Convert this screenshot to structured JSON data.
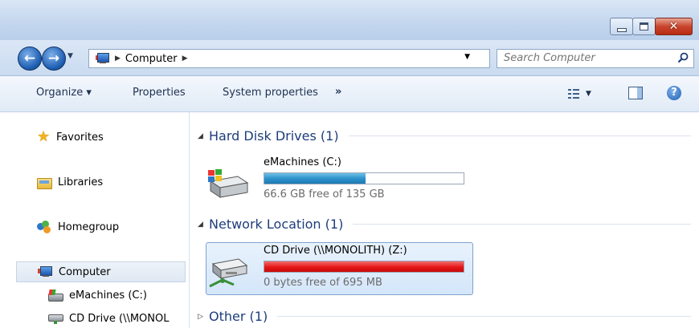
{
  "address": {
    "location": "Computer",
    "search_placeholder": "Search Computer"
  },
  "toolbar": {
    "organize": "Organize ▾",
    "properties": "Properties",
    "system_properties": "System properties",
    "more": "»"
  },
  "window_controls": {
    "minimize_icon": "minimize-icon",
    "maximize_icon": "maximize-icon",
    "close_icon": "close-icon",
    "close_glyph": "✕"
  },
  "nav": {
    "favorites": "Favorites",
    "libraries": "Libraries",
    "homegroup": "Homegroup",
    "computer": "Computer",
    "drive_c": "eMachines (C:)",
    "drive_z": "CD Drive (\\\\MONOL"
  },
  "groups": {
    "hard_disks": "Hard Disk Drives (1)",
    "network": "Network Location (1)",
    "other": "Other (1)"
  },
  "drives": {
    "c": {
      "name": "eMachines (C:)",
      "info": "66.6 GB free of 135 GB",
      "used_fraction": 0.51,
      "bar_color": "#2a8fc9"
    },
    "z": {
      "name": "CD Drive (\\\\MONOLITH) (Z:)",
      "info": "0 bytes free of 695 MB",
      "used_fraction": 1.0,
      "bar_color": "#e51616"
    }
  }
}
